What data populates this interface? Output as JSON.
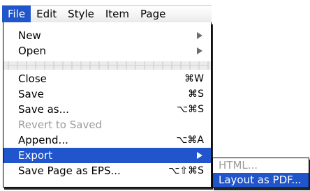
{
  "menubar": {
    "items": [
      {
        "label": "File"
      },
      {
        "label": "Edit"
      },
      {
        "label": "Style"
      },
      {
        "label": "Item"
      },
      {
        "label": "Page"
      }
    ]
  },
  "file_menu": {
    "items": [
      {
        "label": "New",
        "submenu": true
      },
      {
        "label": "Open",
        "submenu": true
      },
      {
        "label": "Close",
        "shortcut": "⌘W"
      },
      {
        "label": "Save",
        "shortcut": "⌘S"
      },
      {
        "label": "Save as...",
        "shortcut": "⌥⌘S"
      },
      {
        "label": "Revert to Saved",
        "disabled": true
      },
      {
        "label": "Append...",
        "shortcut": "⌥⌘A"
      },
      {
        "label": "Export",
        "submenu": true,
        "highlighted": true
      },
      {
        "label": "Save Page as EPS...",
        "shortcut": "⌥⇧⌘S"
      }
    ]
  },
  "export_submenu": {
    "items": [
      {
        "label": "HTML...",
        "disabled": true
      },
      {
        "label": "Layout as PDF...",
        "highlighted": true
      }
    ]
  },
  "colors": {
    "highlight": "#2055cc",
    "disabled_text": "#9b9b9b"
  }
}
